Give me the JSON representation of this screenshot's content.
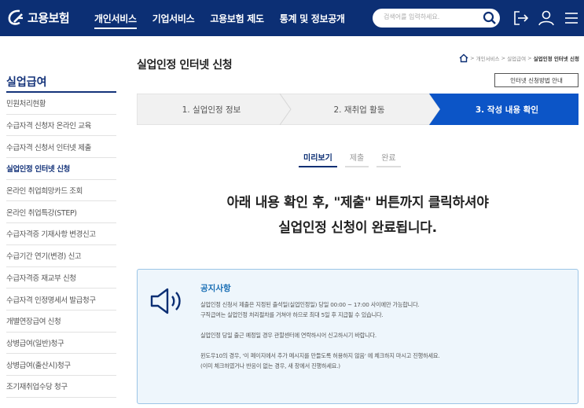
{
  "header": {
    "logo_text": "고용보험",
    "nav": [
      "개인서비스",
      "기업서비스",
      "고용보험 제도",
      "통계 및 정보공개"
    ],
    "search_placeholder": "검색어를 입력하세요."
  },
  "sidebar": {
    "title": "실업급여",
    "items": [
      "민원처리현황",
      "수급자격 신청자 온라인 교육",
      "수급자격 신청서 인터넷 제출",
      "실업인정 인터넷 신청",
      "온라인 취업희망카드 조회",
      "온라인 취업특강(STEP)",
      "수급자격증 기재사항 변경신고",
      "수급기간 연기(변경) 신고",
      "수급자격증 재교부 신청",
      "수급자격 인정명세서 발급청구",
      "개별연장급여 신청",
      "상병급여(일반)청구",
      "상병급여(출산시)청구",
      "조기재취업수당 청구"
    ],
    "active_index": 3
  },
  "main": {
    "page_title": "실업인정 인터넷 신청",
    "breadcrumb": [
      "개인서비스",
      "실업급여",
      "실업인정 인터넷 신청"
    ],
    "guide_button": "인터넷 신청방법 안내",
    "steps": [
      "1. 실업인정 정보",
      "2. 재취업 활동",
      "3. 작성 내용 확인"
    ],
    "active_step": 2,
    "subtabs": [
      "미리보기",
      "제출",
      "완료"
    ],
    "active_subtab": 0,
    "headline_line1": "아래 내용 확인 후, \"제출\" 버튼까지 클릭하셔야",
    "headline_line2": "실업인정 신청이 완료됩니다.",
    "notice": {
      "title": "공지사항",
      "lines": [
        "실업인정 신청서 제출은 지정된 출석일(실업인정일) 당일 00:00 ~ 17:00 사이에만 가능합니다.",
        "구직급여는 실업인정 처리절차를 거쳐야 하므로 최대 5일 후 지급될 수 있습니다.",
        "실업인정 당일 출근 예정일 경우 관할센터에 연락하시어 신고하시기 바랍니다.",
        "윈도우10의 경우, '이 페이지에서 추가 메시지를 만들도록 허용하지 않음' 에 체크하지 마시고 진행하세요.",
        "(이미 체크하였거나 반응이 없는 경우, 새 창에서 진행하세요.)"
      ]
    }
  },
  "colors": {
    "header_bg": "#0c2f74",
    "step_active": "#0c55c7",
    "step_inactive": "#f1f1f1",
    "notice_bg": "#eef6fc",
    "notice_title": "#1a6fb5"
  }
}
